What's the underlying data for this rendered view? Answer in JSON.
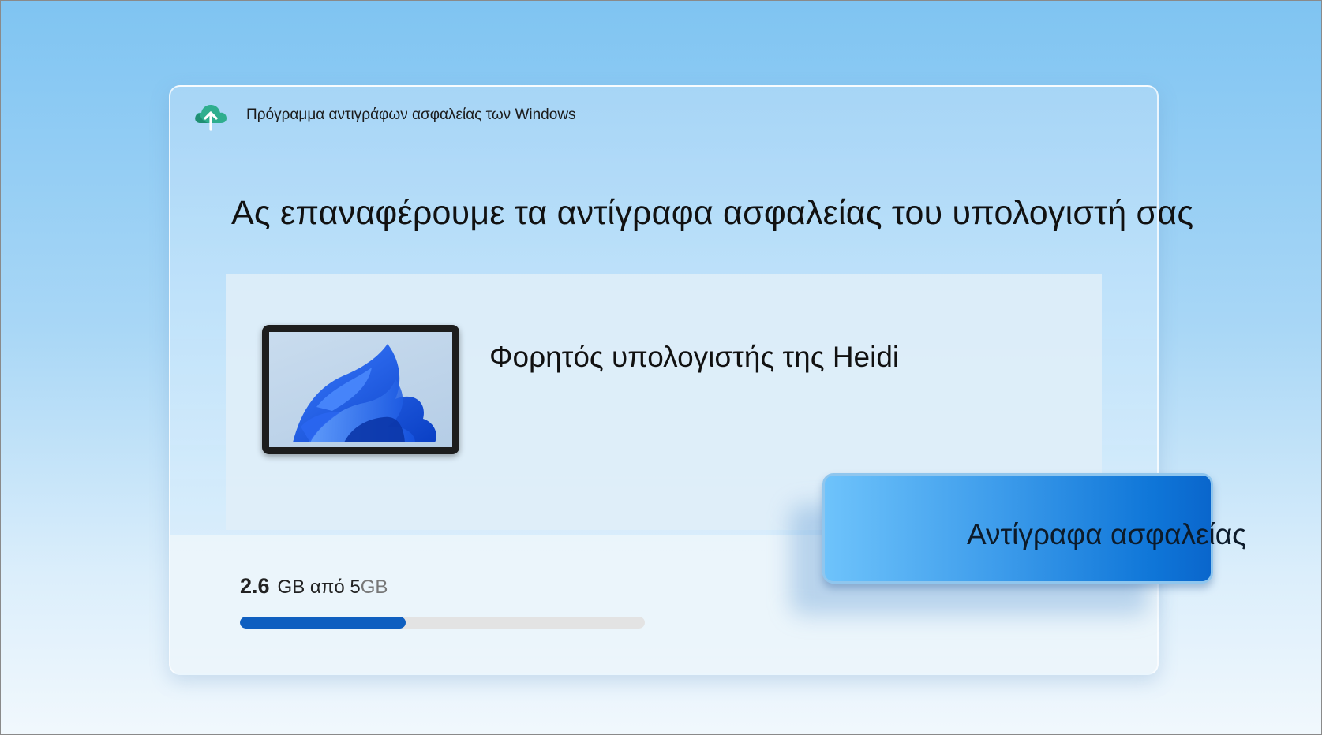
{
  "app": {
    "title": "Πρόγραμμα αντιγράφων ασφαλείας των Windows",
    "icon": "cloud-upload-icon"
  },
  "headline": "Ας επαναφέρουμε τα αντίγραφα ασφαλείας του υπολογιστή σας",
  "device": {
    "name": "Φορητός υπολογιστής της Heidi",
    "image": "tablet-image"
  },
  "storage": {
    "used": "2.6",
    "rest": "GB από 5",
    "unit": "GB",
    "fraction": 0.41
  },
  "actions": {
    "backup_label": "Αντίγραφα ασφαλείας"
  },
  "colors": {
    "accent": "#0f5fc0",
    "button_start": "#6ec3fb",
    "button_end": "#0a66cc"
  }
}
